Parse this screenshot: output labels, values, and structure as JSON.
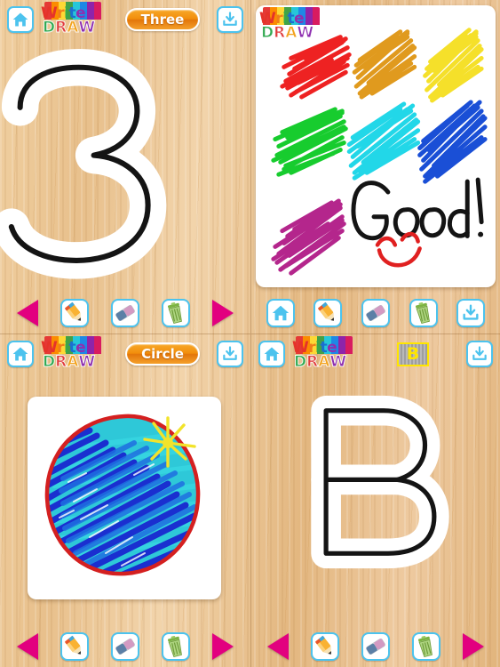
{
  "app": {
    "logo": {
      "line1": "Write",
      "line2": "DRAW"
    }
  },
  "panels": [
    {
      "id": "top-left",
      "header": {
        "home_label": "Home",
        "home_icon": "home-icon",
        "title": "Three",
        "title_kind": "pill",
        "download_label": "Save",
        "download_icon": "download-icon"
      },
      "canvas": {
        "kind": "trace-glyph",
        "glyph": "3",
        "description": "Traceable numeral three outline with black traced stroke"
      },
      "toolbar": {
        "items": [
          {
            "name": "prev-button",
            "icon": "arrow-left-icon",
            "label": "Previous"
          },
          {
            "name": "pencil-tool",
            "icon": "pencil-icon",
            "label": "Pencil"
          },
          {
            "name": "eraser-tool",
            "icon": "eraser-icon",
            "label": "Eraser"
          },
          {
            "name": "clear-tool",
            "icon": "trash-icon",
            "label": "Clear"
          },
          {
            "name": "next-button",
            "icon": "arrow-right-icon",
            "label": "Next"
          }
        ]
      }
    },
    {
      "id": "top-right",
      "header": {
        "logo_only": true
      },
      "canvas": {
        "kind": "free-draw",
        "text_drawing": "Good!",
        "swatch_colors": [
          "#ee2222",
          "#e09a1e",
          "#f5e02a",
          "#17cc2e",
          "#22d7e8",
          "#1a4fd6",
          "#b4268c"
        ],
        "smile_color": "#e02020"
      },
      "toolbar": {
        "items": [
          {
            "name": "home-button",
            "icon": "home-icon",
            "label": "Home"
          },
          {
            "name": "pencil-tool",
            "icon": "pencil-icon",
            "label": "Pencil"
          },
          {
            "name": "eraser-tool",
            "icon": "eraser-icon",
            "label": "Eraser"
          },
          {
            "name": "clear-tool",
            "icon": "trash-icon",
            "label": "Clear"
          },
          {
            "name": "download-button",
            "icon": "download-icon",
            "label": "Save"
          }
        ]
      }
    },
    {
      "id": "bottom-left",
      "header": {
        "home_label": "Home",
        "home_icon": "home-icon",
        "title": "Circle",
        "title_kind": "pill",
        "download_label": "Save",
        "download_icon": "download-icon"
      },
      "canvas": {
        "kind": "colored-drawing",
        "description": "Coloured-in circle: red outline, blue and cyan scribble fill, yellow sparkle",
        "outline_color": "#d42020",
        "fill_colors": [
          "#1a2fd0",
          "#1e9fe0",
          "#2ec8d8"
        ],
        "sparkle_color": "#f2e32a"
      },
      "toolbar": {
        "items": [
          {
            "name": "prev-button",
            "icon": "arrow-left-icon",
            "label": "Previous"
          },
          {
            "name": "pencil-tool",
            "icon": "pencil-icon",
            "label": "Pencil"
          },
          {
            "name": "eraser-tool",
            "icon": "eraser-icon",
            "label": "Eraser"
          },
          {
            "name": "clear-tool",
            "icon": "trash-icon",
            "label": "Clear"
          },
          {
            "name": "next-button",
            "icon": "arrow-right-icon",
            "label": "Next"
          }
        ]
      }
    },
    {
      "id": "bottom-right",
      "header": {
        "home_label": "Home",
        "home_icon": "home-icon",
        "title": "B",
        "title_kind": "badge",
        "download_label": "Save",
        "download_icon": "download-icon"
      },
      "canvas": {
        "kind": "trace-glyph",
        "glyph": "B",
        "description": "Traceable capital letter B outline with black traced stroke"
      },
      "toolbar": {
        "items": [
          {
            "name": "prev-button",
            "icon": "arrow-left-icon",
            "label": "Previous"
          },
          {
            "name": "pencil-tool",
            "icon": "pencil-icon",
            "label": "Pencil"
          },
          {
            "name": "eraser-tool",
            "icon": "eraser-icon",
            "label": "Eraser"
          },
          {
            "name": "clear-tool",
            "icon": "trash-icon",
            "label": "Clear"
          },
          {
            "name": "next-button",
            "icon": "arrow-right-icon",
            "label": "Next"
          }
        ]
      }
    }
  ],
  "colors": {
    "wood": "#e5bb85",
    "accent_cyan": "#4cc3ee",
    "accent_magenta": "#e2007f",
    "pill_orange": "#f28e0c",
    "badge_yellow": "#ffe600"
  }
}
